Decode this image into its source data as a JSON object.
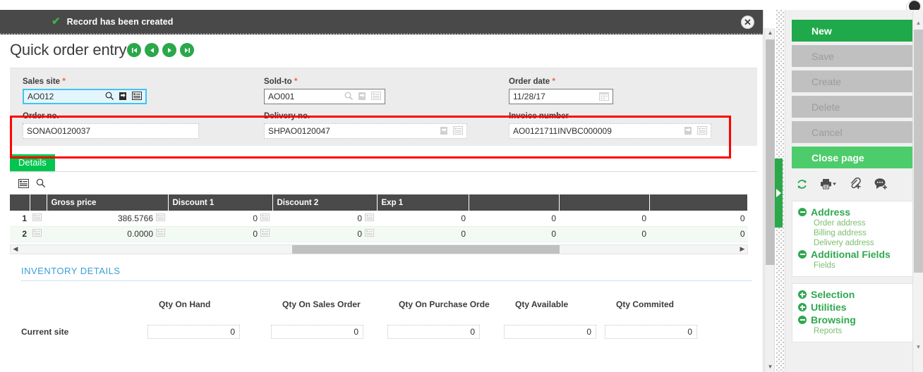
{
  "notification": {
    "message": "Record has been created",
    "check_icon": "check-icon",
    "close_icon": "close-circle-icon"
  },
  "header": {
    "title": "Quick order entry",
    "nav_buttons": [
      {
        "name": "first",
        "glyph": "⏮"
      },
      {
        "name": "previous",
        "glyph": "◀"
      },
      {
        "name": "next",
        "glyph": "▶"
      },
      {
        "name": "last",
        "glyph": "⏭"
      }
    ]
  },
  "form": {
    "required_mark": "*",
    "fields": [
      {
        "label": "Sales site",
        "value": "AO012",
        "required": true,
        "state": "focused",
        "icons": [
          "search-icon",
          "jump-to-icon",
          "list-icon"
        ]
      },
      {
        "label": "Sold-to",
        "value": "AO001",
        "required": true,
        "state": "normal",
        "icons": [
          "search-icon",
          "jump-to-icon",
          "list-icon"
        ]
      },
      {
        "label": "Order date",
        "value": "11/28/17",
        "required": true,
        "state": "normal",
        "icons": [
          "calendar-icon"
        ]
      },
      {
        "label": "Order no.",
        "value": "SONAO0120037",
        "required": false,
        "state": "readonly",
        "icons": []
      },
      {
        "label": "Delivery no.",
        "value": "SHPAO0120047",
        "required": false,
        "state": "readonly",
        "icons": [
          "jump-to-icon",
          "list-icon"
        ]
      },
      {
        "label": "Invoice number",
        "value": "AO0121711INVBC000009",
        "required": false,
        "state": "readonly",
        "icons": [
          "jump-to-icon",
          "list-icon"
        ]
      }
    ],
    "highlight_color": "#ff0000"
  },
  "tabs": [
    {
      "label": "Details",
      "active": true
    }
  ],
  "grid": {
    "tools": [
      "list-view-icon",
      "search-icon"
    ],
    "columns": [
      "",
      "",
      "Gross price",
      "Discount 1",
      "Discount 2",
      "Exp 1",
      "",
      "",
      ""
    ],
    "rows": [
      {
        "num": "1",
        "gross_price": "386.5766",
        "discount1": "0",
        "discount2": "0",
        "exp1": "0",
        "c7": "0",
        "c8": "0",
        "c9": "0"
      },
      {
        "num": "2",
        "gross_price": "0.0000",
        "discount1": "0",
        "discount2": "0",
        "exp1": "0",
        "c7": "0",
        "c8": "0",
        "c9": "0"
      }
    ],
    "scroll_left_arrow": "◀",
    "scroll_right_arrow": "▶"
  },
  "inventory": {
    "title": "INVENTORY DETAILS",
    "columns": [
      "Qty On Hand",
      "Qty On Sales Order",
      "Qty On Purchase Orde",
      "Qty Available",
      "Qty Commited"
    ],
    "rows": [
      {
        "label": "Current site",
        "values": [
          "0",
          "0",
          "0",
          "0",
          "0"
        ]
      }
    ]
  },
  "sidebar": {
    "buttons": [
      {
        "label": "New",
        "style": "primary"
      },
      {
        "label": "Save",
        "style": "disabled"
      },
      {
        "label": "Create",
        "style": "disabled"
      },
      {
        "label": "Delete",
        "style": "disabled"
      },
      {
        "label": "Cancel",
        "style": "disabled"
      },
      {
        "label": "Close page",
        "style": "close"
      }
    ],
    "tool_icons": [
      "refresh-icon",
      "print-icon",
      "attachment-icon",
      "comment-icon"
    ],
    "groups": [
      {
        "title": "Address",
        "expanded": true,
        "links": [
          "Order address",
          "Billing address",
          "Delivery address"
        ]
      },
      {
        "title": "Additional Fields",
        "expanded": true,
        "links": [
          "Fields"
        ]
      },
      {
        "title": "Selection",
        "expanded": false,
        "links": []
      },
      {
        "title": "Utilities",
        "expanded": false,
        "links": []
      },
      {
        "title": "Browsing",
        "expanded": true,
        "links": [
          "Reports"
        ]
      }
    ]
  },
  "colors": {
    "green": "#1fa94a",
    "tab_green": "#00c650",
    "notif_bg": "#494949",
    "table_header": "#4a4a4a",
    "link_blue": "#3a9fd6",
    "highlight_red": "#ff0000"
  }
}
